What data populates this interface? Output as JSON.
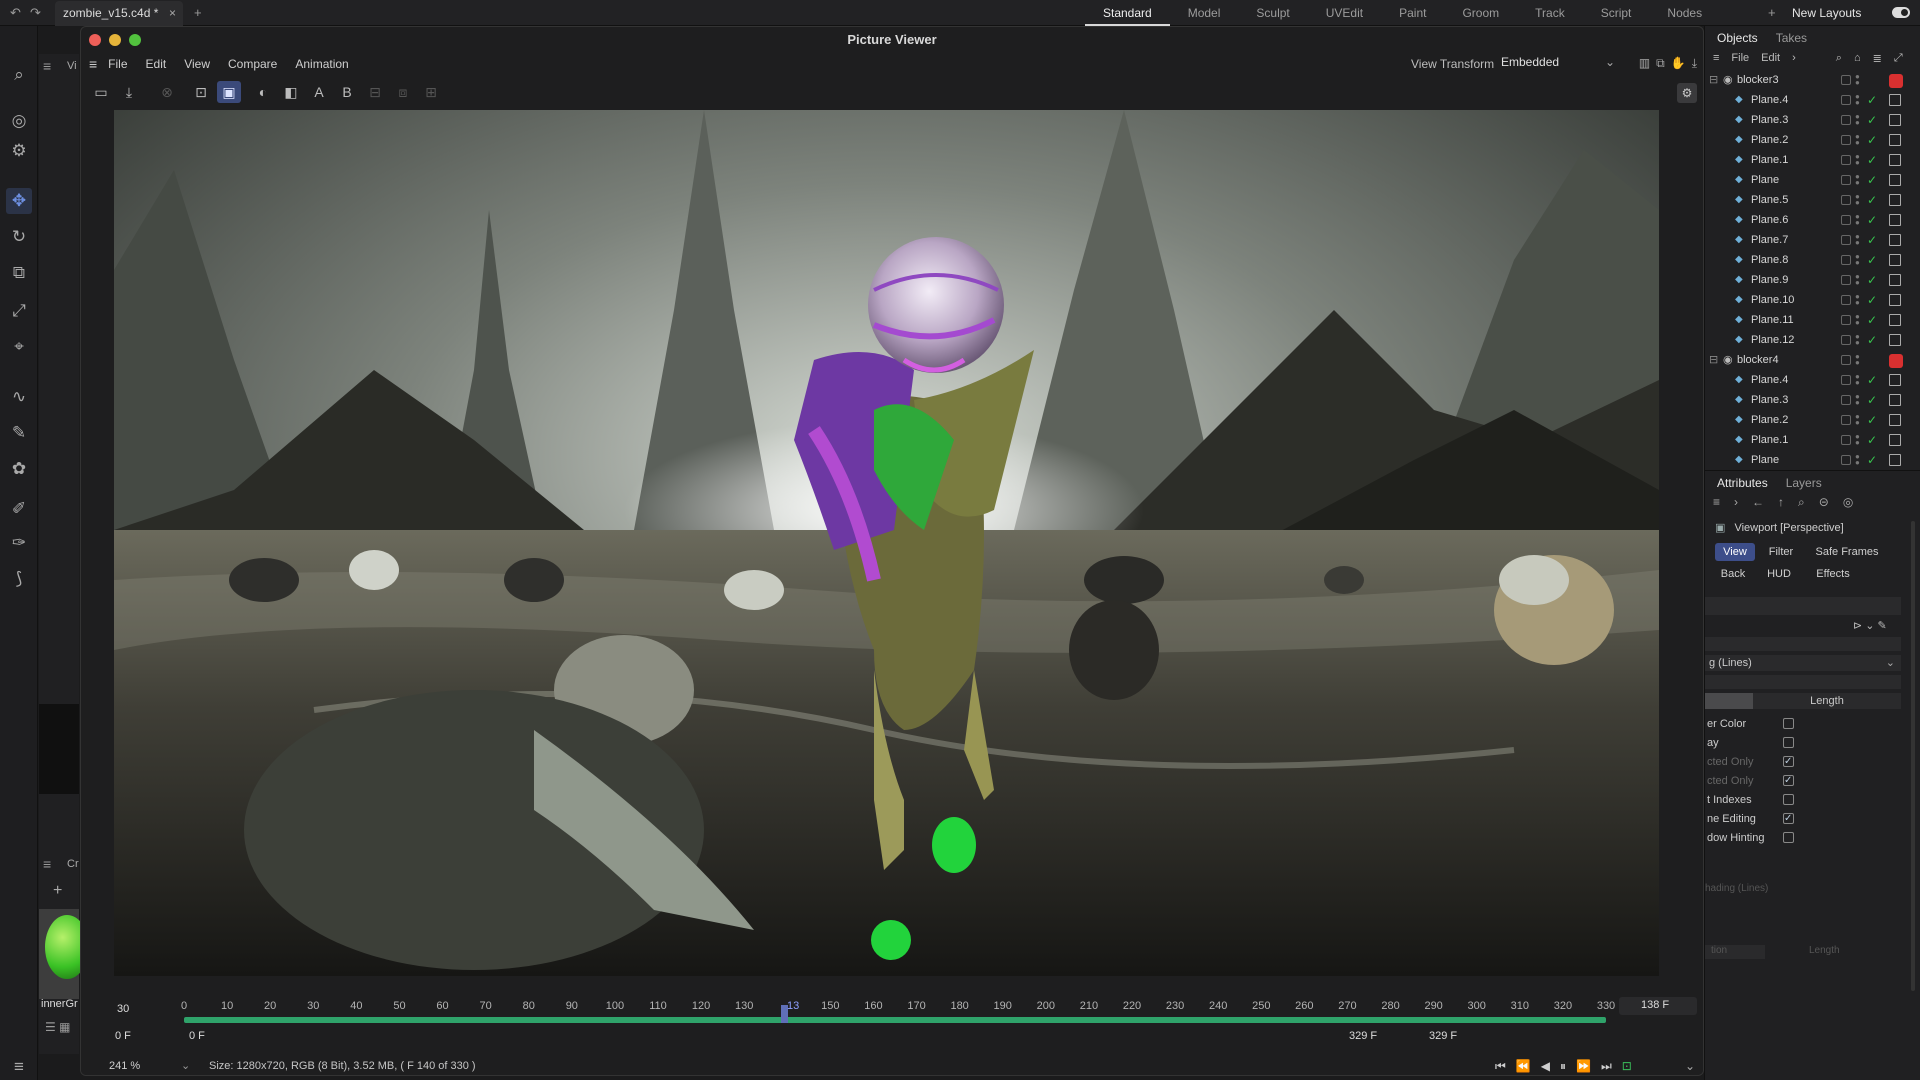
{
  "topbar": {
    "document_tab": "zombie_v15.c4d *",
    "layout_tabs": [
      "Standard",
      "Model",
      "Sculpt",
      "UVEdit",
      "Paint",
      "Groom",
      "Track",
      "Script",
      "Nodes"
    ],
    "active_layout": "Standard",
    "new_layouts": "New Layouts"
  },
  "viewer": {
    "title": "Picture Viewer",
    "menu": [
      "File",
      "Edit",
      "View",
      "Compare",
      "Animation"
    ],
    "view_transform_label": "View Transform",
    "view_transform_value": "Embedded",
    "toolbar_letters": {
      "a": "A",
      "b": "B"
    },
    "timeline": {
      "fps": "30",
      "start": "0 F",
      "start2": "0 F",
      "end": "329 F",
      "end2": "329 F",
      "current": "138 F",
      "current_partial": "13",
      "ticks": [
        "0",
        "10",
        "20",
        "30",
        "40",
        "50",
        "60",
        "70",
        "80",
        "90",
        "100",
        "110",
        "120",
        "130",
        "150",
        "160",
        "170",
        "180",
        "190",
        "200",
        "210",
        "220",
        "230",
        "240",
        "250",
        "260",
        "270",
        "280",
        "290",
        "300",
        "310",
        "320",
        "330"
      ],
      "progress": 0.42
    },
    "status": {
      "zoom": "241 %",
      "info": "Size: 1280x720, RGB (8 Bit), 3.52 MB,  ( F 140 of 330 )"
    }
  },
  "objects_panel": {
    "tabs": [
      "Objects",
      "Takes"
    ],
    "toolbar": [
      "File",
      "Edit"
    ],
    "rows": [
      {
        "name": "blocker3",
        "level": 0,
        "type": "null"
      },
      {
        "name": "Plane.4",
        "level": 1,
        "type": "plane"
      },
      {
        "name": "Plane.3",
        "level": 1,
        "type": "plane"
      },
      {
        "name": "Plane.2",
        "level": 1,
        "type": "plane"
      },
      {
        "name": "Plane.1",
        "level": 1,
        "type": "plane"
      },
      {
        "name": "Plane",
        "level": 1,
        "type": "plane"
      },
      {
        "name": "Plane.5",
        "level": 1,
        "type": "plane"
      },
      {
        "name": "Plane.6",
        "level": 1,
        "type": "plane"
      },
      {
        "name": "Plane.7",
        "level": 1,
        "type": "plane"
      },
      {
        "name": "Plane.8",
        "level": 1,
        "type": "plane"
      },
      {
        "name": "Plane.9",
        "level": 1,
        "type": "plane"
      },
      {
        "name": "Plane.10",
        "level": 1,
        "type": "plane"
      },
      {
        "name": "Plane.11",
        "level": 1,
        "type": "plane"
      },
      {
        "name": "Plane.12",
        "level": 1,
        "type": "plane"
      },
      {
        "name": "blocker4",
        "level": 0,
        "type": "null"
      },
      {
        "name": "Plane.4",
        "level": 1,
        "type": "plane"
      },
      {
        "name": "Plane.3",
        "level": 1,
        "type": "plane"
      },
      {
        "name": "Plane.2",
        "level": 1,
        "type": "plane"
      },
      {
        "name": "Plane.1",
        "level": 1,
        "type": "plane"
      },
      {
        "name": "Plane",
        "level": 1,
        "type": "plane"
      }
    ]
  },
  "attributes_panel": {
    "tabs": [
      "Attributes",
      "Layers"
    ],
    "header": "Viewport [Perspective]",
    "buttons": [
      "View",
      "Filter",
      "Safe Frames",
      "Back",
      "HUD",
      "Effects"
    ],
    "active_button": "View",
    "dropdown_value": "g (Lines)",
    "length_label": "Length",
    "rows": [
      {
        "label": "er Color",
        "checked": false
      },
      {
        "label": "ay",
        "checked": false
      },
      {
        "label": "cted Only",
        "checked": true,
        "dim": true
      },
      {
        "label": "cted Only",
        "checked": true,
        "dim": true
      },
      {
        "label": "t Indexes",
        "checked": false
      },
      {
        "label": "ne Editing",
        "checked": true
      },
      {
        "label": "dow Hinting",
        "checked": false
      }
    ],
    "shading_lines": "hading (Lines)",
    "bottom_length": "Length",
    "bottom_left": "tion"
  },
  "left_panel": {
    "sphere_label": "innerGr",
    "top_label": "Vi",
    "mid_label": "Cr"
  }
}
